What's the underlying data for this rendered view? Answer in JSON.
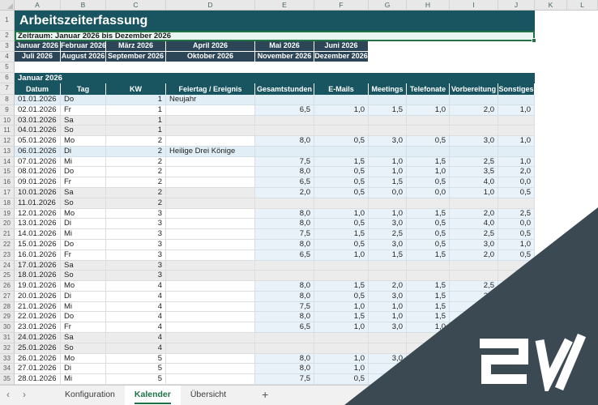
{
  "title": "Arbeitszeiterfassung",
  "subtitle": "Zeitraum: Januar 2026 bis Dezember 2026",
  "columns": {
    "letters": [
      "A",
      "B",
      "C",
      "D",
      "E",
      "F",
      "G",
      "H",
      "I",
      "J",
      "K",
      "L"
    ]
  },
  "gutter_rows": [
    "1",
    "2",
    "3",
    "4",
    "5",
    "6",
    "7"
  ],
  "month_buttons": {
    "row3": [
      "Januar 2026",
      "Februar 2026",
      "März 2026",
      "April 2026",
      "Mai 2026",
      "Juni 2026"
    ],
    "row4": [
      "Juli 2026",
      "August 2026",
      "September 2026",
      "Oktober 2026",
      "November 2026",
      "Dezember 2026"
    ]
  },
  "section": {
    "month_label": "Januar 2026"
  },
  "table": {
    "headers": [
      "Datum",
      "Tag",
      "KW",
      "Feiertag / Ereignis",
      "Gesamtstunden",
      "E-Mails",
      "Meetings",
      "Telefonate",
      "Vorbereitung",
      "Sonstiges"
    ],
    "rows": [
      {
        "row": "8",
        "datum": "01.01.2026",
        "tag": "Do",
        "kw": "1",
        "feiertag": "Neujahr",
        "values": [
          "",
          "",
          "",
          "",
          "",
          ""
        ],
        "shade": "holiday"
      },
      {
        "row": "9",
        "datum": "02.01.2026",
        "tag": "Fr",
        "kw": "1",
        "feiertag": "",
        "values": [
          "6,5",
          "1,0",
          "1,5",
          "1,0",
          "2,0",
          "1,0"
        ],
        "shade": "normal"
      },
      {
        "row": "10",
        "datum": "03.01.2026",
        "tag": "Sa",
        "kw": "1",
        "feiertag": "",
        "values": [
          "",
          "",
          "",
          "",
          "",
          ""
        ],
        "shade": "weekend"
      },
      {
        "row": "11",
        "datum": "04.01.2026",
        "tag": "So",
        "kw": "1",
        "feiertag": "",
        "values": [
          "",
          "",
          "",
          "",
          "",
          ""
        ],
        "shade": "weekend"
      },
      {
        "row": "12",
        "datum": "05.01.2026",
        "tag": "Mo",
        "kw": "2",
        "feiertag": "",
        "values": [
          "8,0",
          "0,5",
          "3,0",
          "0,5",
          "3,0",
          "1,0"
        ],
        "shade": "normal"
      },
      {
        "row": "13",
        "datum": "06.01.2026",
        "tag": "Di",
        "kw": "2",
        "feiertag": "Heilige Drei Könige",
        "values": [
          "",
          "",
          "",
          "",
          "",
          ""
        ],
        "shade": "holiday"
      },
      {
        "row": "14",
        "datum": "07.01.2026",
        "tag": "Mi",
        "kw": "2",
        "feiertag": "",
        "values": [
          "7,5",
          "1,5",
          "1,0",
          "1,5",
          "2,5",
          "1,0"
        ],
        "shade": "normal"
      },
      {
        "row": "15",
        "datum": "08.01.2026",
        "tag": "Do",
        "kw": "2",
        "feiertag": "",
        "values": [
          "8,0",
          "0,5",
          "1,0",
          "1,0",
          "3,5",
          "2,0"
        ],
        "shade": "normal"
      },
      {
        "row": "16",
        "datum": "09.01.2026",
        "tag": "Fr",
        "kw": "2",
        "feiertag": "",
        "values": [
          "6,5",
          "0,5",
          "1,5",
          "0,5",
          "4,0",
          "0,0"
        ],
        "shade": "normal"
      },
      {
        "row": "17",
        "datum": "10.01.2026",
        "tag": "Sa",
        "kw": "2",
        "feiertag": "",
        "values": [
          "2,0",
          "0,5",
          "0,0",
          "0,0",
          "1,0",
          "0,5"
        ],
        "shade": "weekend"
      },
      {
        "row": "18",
        "datum": "11.01.2026",
        "tag": "So",
        "kw": "2",
        "feiertag": "",
        "values": [
          "",
          "",
          "",
          "",
          "",
          ""
        ],
        "shade": "weekend"
      },
      {
        "row": "19",
        "datum": "12.01.2026",
        "tag": "Mo",
        "kw": "3",
        "feiertag": "",
        "values": [
          "8,0",
          "1,0",
          "1,0",
          "1,5",
          "2,0",
          "2,5"
        ],
        "shade": "normal"
      },
      {
        "row": "20",
        "datum": "13.01.2026",
        "tag": "Di",
        "kw": "3",
        "feiertag": "",
        "values": [
          "8,0",
          "0,5",
          "3,0",
          "0,5",
          "4,0",
          "0,0"
        ],
        "shade": "normal"
      },
      {
        "row": "21",
        "datum": "14.01.2026",
        "tag": "Mi",
        "kw": "3",
        "feiertag": "",
        "values": [
          "7,5",
          "1,5",
          "2,5",
          "0,5",
          "2,5",
          "0,5"
        ],
        "shade": "normal"
      },
      {
        "row": "22",
        "datum": "15.01.2026",
        "tag": "Do",
        "kw": "3",
        "feiertag": "",
        "values": [
          "8,0",
          "0,5",
          "3,0",
          "0,5",
          "3,0",
          "1,0"
        ],
        "shade": "normal"
      },
      {
        "row": "23",
        "datum": "16.01.2026",
        "tag": "Fr",
        "kw": "3",
        "feiertag": "",
        "values": [
          "6,5",
          "1,0",
          "1,5",
          "1,5",
          "2,0",
          "0,5"
        ],
        "shade": "normal"
      },
      {
        "row": "24",
        "datum": "17.01.2026",
        "tag": "Sa",
        "kw": "3",
        "feiertag": "",
        "values": [
          "",
          "",
          "",
          "",
          "",
          ""
        ],
        "shade": "weekend"
      },
      {
        "row": "25",
        "datum": "18.01.2026",
        "tag": "So",
        "kw": "3",
        "feiertag": "",
        "values": [
          "",
          "",
          "",
          "",
          "",
          ""
        ],
        "shade": "weekend"
      },
      {
        "row": "26",
        "datum": "19.01.2026",
        "tag": "Mo",
        "kw": "4",
        "feiertag": "",
        "values": [
          "8,0",
          "1,5",
          "2,0",
          "1,5",
          "2,5",
          ""
        ],
        "shade": "normal"
      },
      {
        "row": "27",
        "datum": "20.01.2026",
        "tag": "Di",
        "kw": "4",
        "feiertag": "",
        "values": [
          "8,0",
          "0,5",
          "3,0",
          "1,5",
          "2,5",
          ""
        ],
        "shade": "normal"
      },
      {
        "row": "28",
        "datum": "21.01.2026",
        "tag": "Mi",
        "kw": "4",
        "feiertag": "",
        "values": [
          "7,5",
          "1,0",
          "1,0",
          "1,5",
          "",
          ""
        ],
        "shade": "normal"
      },
      {
        "row": "29",
        "datum": "22.01.2026",
        "tag": "Do",
        "kw": "4",
        "feiertag": "",
        "values": [
          "8,0",
          "1,5",
          "1,0",
          "1,5",
          "",
          ""
        ],
        "shade": "normal"
      },
      {
        "row": "30",
        "datum": "23.01.2026",
        "tag": "Fr",
        "kw": "4",
        "feiertag": "",
        "values": [
          "6,5",
          "1,0",
          "3,0",
          "1,0",
          "",
          ""
        ],
        "shade": "normal"
      },
      {
        "row": "31",
        "datum": "24.01.2026",
        "tag": "Sa",
        "kw": "4",
        "feiertag": "",
        "values": [
          "",
          "",
          "",
          "",
          "",
          ""
        ],
        "shade": "weekend"
      },
      {
        "row": "32",
        "datum": "25.01.2026",
        "tag": "So",
        "kw": "4",
        "feiertag": "",
        "values": [
          "",
          "",
          "",
          "",
          "",
          ""
        ],
        "shade": "weekend"
      },
      {
        "row": "33",
        "datum": "26.01.2026",
        "tag": "Mo",
        "kw": "5",
        "feiertag": "",
        "values": [
          "8,0",
          "1,0",
          "3,0",
          "",
          "",
          ""
        ],
        "shade": "normal"
      },
      {
        "row": "34",
        "datum": "27.01.2026",
        "tag": "Di",
        "kw": "5",
        "feiertag": "",
        "values": [
          "8,0",
          "1,0",
          "",
          "",
          "",
          ""
        ],
        "shade": "normal"
      },
      {
        "row": "35",
        "datum": "28.01.2026",
        "tag": "Mi",
        "kw": "5",
        "feiertag": "",
        "values": [
          "7,5",
          "0,5",
          "",
          "",
          "",
          ""
        ],
        "shade": "normal"
      }
    ]
  },
  "tabs": {
    "nav_left": "‹",
    "nav_right": "›",
    "items": [
      "Konfiguration",
      "Kalender",
      "Übersicht"
    ],
    "active": "Kalender",
    "add_label": "+"
  },
  "watermark": {
    "logo": "EW",
    "triangle_color": "#3b4a52"
  },
  "colors": {
    "header_teal": "#195560",
    "button_slate": "#2c4657",
    "subtitle_mint": "#e9f5f1",
    "data_blue": "#e9f2f8",
    "holiday_blue": "#e1eef6",
    "weekend_gray": "#ececec",
    "accent_green": "#217346"
  }
}
